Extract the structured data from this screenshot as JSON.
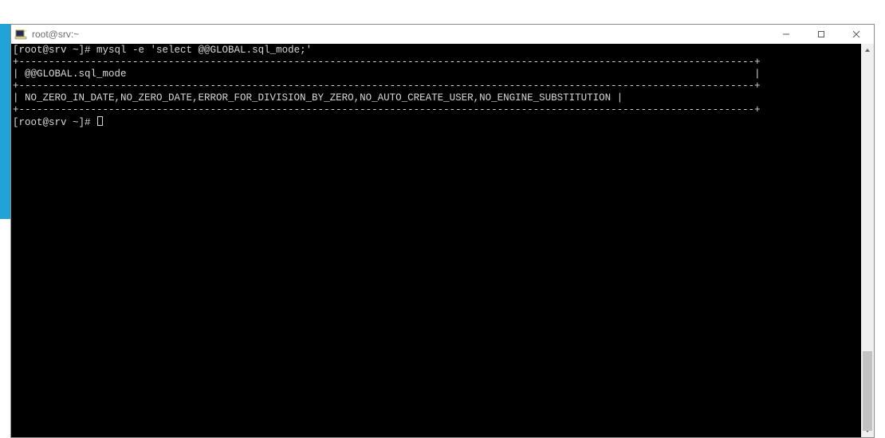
{
  "window": {
    "title": "root@srv:~"
  },
  "terminal": {
    "prompt": "[root@srv ~]# ",
    "command": "mysql -e 'select @@GLOBAL.sql_mode;'",
    "border_top": "+---------------------------------------------------------------------------------------------------------------------------+",
    "header_line": "| @@GLOBAL.sql_mode                                                                                                         |",
    "border_mid": "+---------------------------------------------------------------------------------------------------------------------------+",
    "value_line": "| NO_ZERO_IN_DATE,NO_ZERO_DATE,ERROR_FOR_DIVISION_BY_ZERO,NO_AUTO_CREATE_USER,NO_ENGINE_SUBSTITUTION |",
    "border_bot": "+---------------------------------------------------------------------------------------------------------------------------+",
    "prompt2": "[root@srv ~]# "
  }
}
